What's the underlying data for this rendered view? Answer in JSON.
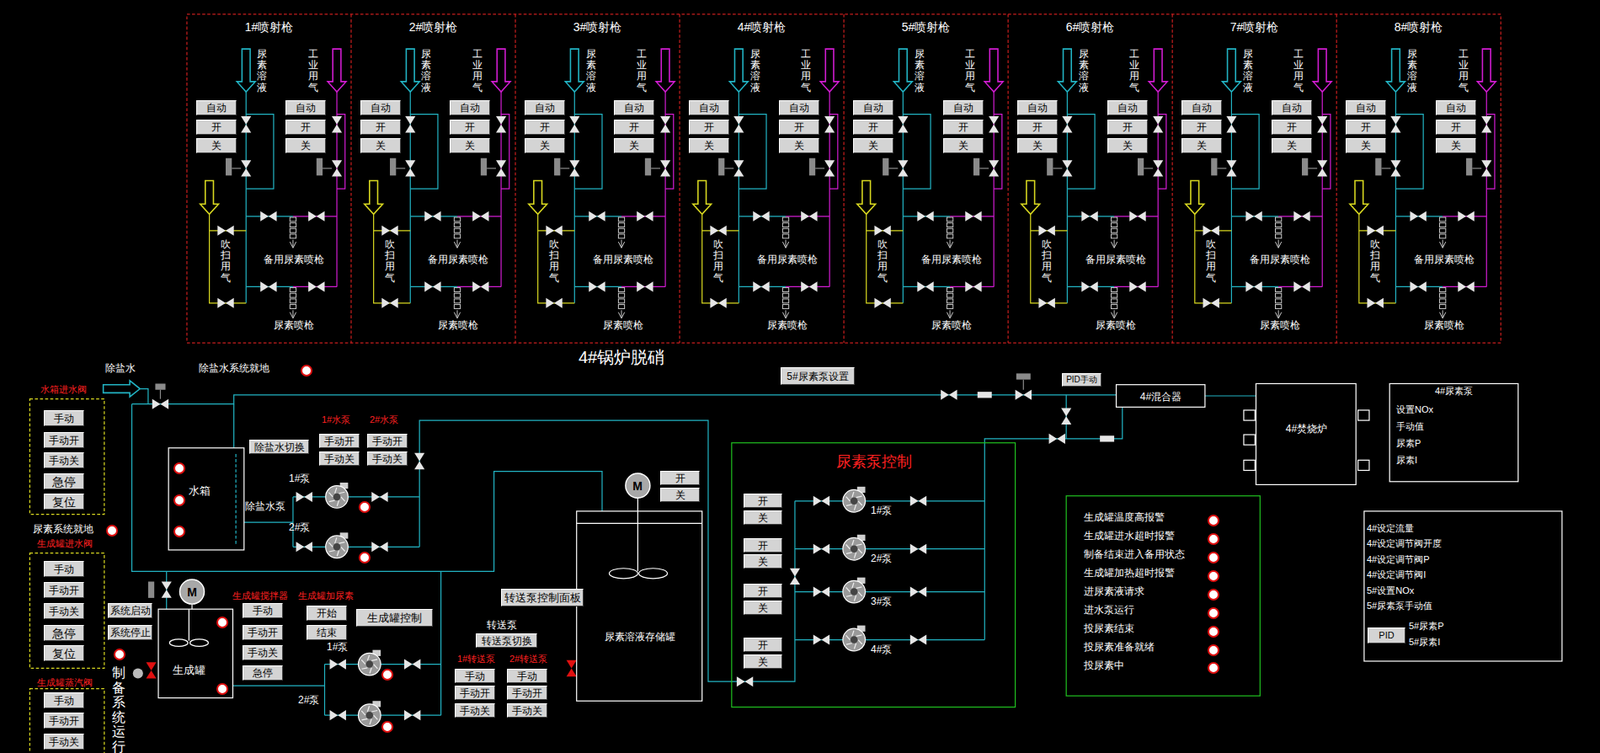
{
  "title": "4#锅炉脱硝",
  "guns": [
    {
      "name": "1#喷射枪",
      "urea": "尿素溶液",
      "air": "工业用气",
      "purge": "吹扫用气",
      "spare": "备用尿素喷枪",
      "main": "尿素喷枪",
      "urea_buttons": [
        "自动",
        "开",
        "关"
      ],
      "air_buttons": [
        "自动",
        "开",
        "关"
      ]
    },
    {
      "name": "2#喷射枪",
      "urea": "尿素溶液",
      "air": "工业用气",
      "purge": "吹扫用气",
      "spare": "备用尿素喷枪",
      "main": "尿素喷枪",
      "urea_buttons": [
        "自动",
        "开",
        "关"
      ],
      "air_buttons": [
        "自动",
        "开",
        "关"
      ]
    },
    {
      "name": "3#喷射枪",
      "urea": "尿素溶液",
      "air": "工业用气",
      "purge": "吹扫用气",
      "spare": "备用尿素喷枪",
      "main": "尿素喷枪",
      "urea_buttons": [
        "自动",
        "开",
        "关"
      ],
      "air_buttons": [
        "自动",
        "开",
        "关"
      ]
    },
    {
      "name": "4#喷射枪",
      "urea": "尿素溶液",
      "air": "工业用气",
      "purge": "吹扫用气",
      "spare": "备用尿素喷枪",
      "main": "尿素喷枪",
      "urea_buttons": [
        "自动",
        "开",
        "关"
      ],
      "air_buttons": [
        "自动",
        "开",
        "关"
      ]
    },
    {
      "name": "5#喷射枪",
      "urea": "尿素溶液",
      "air": "工业用气",
      "purge": "吹扫用气",
      "spare": "备用尿素喷枪",
      "main": "尿素喷枪",
      "urea_buttons": [
        "自动",
        "开",
        "关"
      ],
      "air_buttons": [
        "自动",
        "开",
        "关"
      ]
    },
    {
      "name": "6#喷射枪",
      "urea": "尿素溶液",
      "air": "工业用气",
      "purge": "吹扫用气",
      "spare": "备用尿素喷枪",
      "main": "尿素喷枪",
      "urea_buttons": [
        "自动",
        "开",
        "关"
      ],
      "air_buttons": [
        "自动",
        "开",
        "关"
      ]
    },
    {
      "name": "7#喷射枪",
      "urea": "尿素溶液",
      "air": "工业用气",
      "purge": "吹扫用气",
      "spare": "备用尿素喷枪",
      "main": "尿素喷枪",
      "urea_buttons": [
        "自动",
        "开",
        "关"
      ],
      "air_buttons": [
        "自动",
        "开",
        "关"
      ]
    },
    {
      "name": "8#喷射枪",
      "urea": "尿素溶液",
      "air": "工业用气",
      "purge": "吹扫用气",
      "spare": "备用尿素喷枪",
      "main": "尿素喷枪",
      "urea_buttons": [
        "自动",
        "开",
        "关"
      ],
      "air_buttons": [
        "自动",
        "开",
        "关"
      ]
    }
  ],
  "desalted_water": {
    "label": "除盐水",
    "local_label": "除盐水系统就地",
    "local_on": false
  },
  "tank_inlet_valve": {
    "title": "水箱进水阀",
    "buttons": [
      "手动",
      "手动开",
      "手动关",
      "急停",
      "复位"
    ]
  },
  "urea_local": {
    "label": "尿素系统就地",
    "on": false
  },
  "gen_inlet_valve": {
    "title": "生成罐进水阀",
    "buttons": [
      "手动",
      "手动开",
      "手动关",
      "急停",
      "复位"
    ]
  },
  "gen_steam_valve": {
    "title": "生成罐蒸汽阀",
    "buttons": [
      "手动",
      "手动开",
      "手动关"
    ]
  },
  "prep_running": {
    "label": "制备系统运行",
    "on": false
  },
  "system_buttons": [
    "系统启动",
    "系统停止"
  ],
  "water_tank": {
    "name": "水箱",
    "switch_button": "除盐水切换",
    "pump_label": "除盐水泵",
    "switches": [
      {
        "on": false
      },
      {
        "on": false
      },
      {
        "on": false
      }
    ]
  },
  "water_pumps": [
    {
      "title": "1#水泵",
      "name": "1#泵",
      "buttons": [
        "手动开",
        "手动关"
      ],
      "running": false
    },
    {
      "title": "2#水泵",
      "name": "2#泵",
      "buttons": [
        "手动开",
        "手动关"
      ],
      "running": false
    }
  ],
  "gen_tank": {
    "name": "生成罐",
    "motor": "M",
    "switches": [
      {
        "on": false
      },
      {
        "on": false
      }
    ]
  },
  "agitator": {
    "title": "生成罐搅拌器",
    "buttons": [
      "手动",
      "手动开",
      "手动关",
      "急停"
    ]
  },
  "urea_add": {
    "title": "生成罐加尿素",
    "buttons": [
      "开始",
      "结束"
    ]
  },
  "gen_control": "生成罐控制",
  "feed_pumps": [
    {
      "name": "1#泵",
      "running": false
    },
    {
      "name": "2#泵",
      "running": false
    }
  ],
  "transfer": {
    "panel_button": "转送泵控制面板",
    "label": "转送泵",
    "switch_button": "转送泵切换",
    "pumps": [
      {
        "title": "1#转送泵",
        "buttons": [
          "手动",
          "手动开",
          "手动关"
        ]
      },
      {
        "title": "2#转送泵",
        "buttons": [
          "手动",
          "手动开",
          "手动关"
        ]
      }
    ]
  },
  "storage_tank": {
    "name": "尿素溶液存储罐",
    "motor": "M",
    "buttons": [
      "开",
      "关"
    ]
  },
  "urea_pump_control": {
    "title": "尿素泵控制",
    "pumps": [
      {
        "name": "1#泵",
        "buttons": [
          "开",
          "关"
        ]
      },
      {
        "name": "2#泵",
        "buttons": [
          "开",
          "关"
        ]
      },
      {
        "name": "3#泵",
        "buttons": [
          "开",
          "关"
        ]
      },
      {
        "name": "4#泵",
        "buttons": [
          "开",
          "关"
        ]
      }
    ]
  },
  "pump5_button": "5#尿素泵设置",
  "pid_manual": "PID手动",
  "mixer": "4#混合器",
  "furnace": "4#焚烧炉",
  "urea_pump4": {
    "title": "4#尿素泵",
    "items": [
      "设置NOx",
      "手动值",
      "尿素P",
      "尿素I"
    ]
  },
  "alarms": [
    {
      "label": "生成罐温度高报警",
      "on": false
    },
    {
      "label": "生成罐进水超时报警",
      "on": false
    },
    {
      "label": "制备结束进入备用状态",
      "on": false
    },
    {
      "label": "生成罐加热超时报警",
      "on": false
    },
    {
      "label": "进尿素液请求",
      "on": false
    },
    {
      "label": "进水泵运行",
      "on": false
    },
    {
      "label": "投尿素结束",
      "on": false
    },
    {
      "label": "投尿素准备就绪",
      "on": false
    },
    {
      "label": "投尿素中",
      "on": false
    }
  ],
  "settings": {
    "items": [
      "4#设定流量",
      "4#设定调节阀开度",
      "4#设定调节阀P",
      "4#设定调节阀I",
      "5#设置NOx",
      "5#尿素泵手动值"
    ],
    "pid_button": "PID",
    "pid_items": [
      "5#尿素P",
      "5#尿素I"
    ]
  }
}
